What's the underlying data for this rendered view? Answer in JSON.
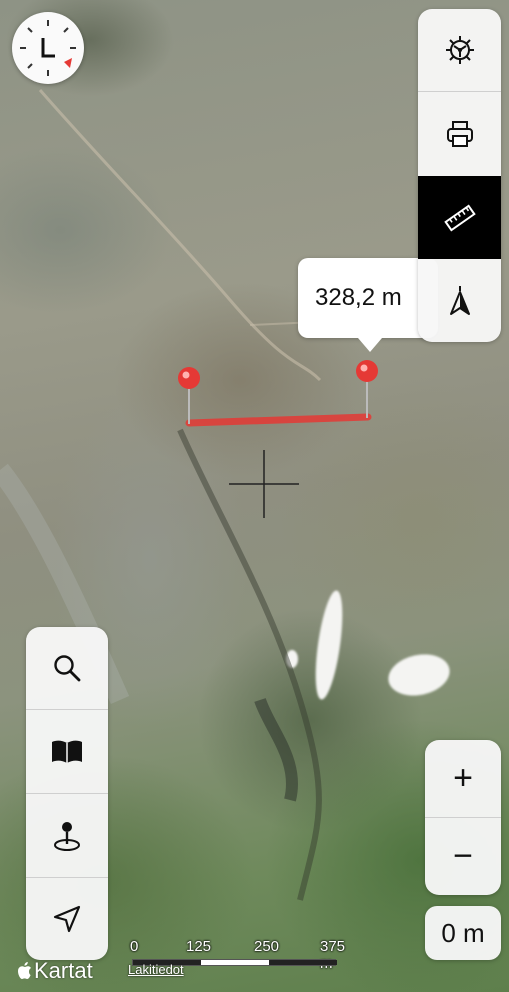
{
  "map": {
    "attribution": "Lakitiedot",
    "logo_text": "Kartat"
  },
  "measure": {
    "distance_label": "328,2 m"
  },
  "top_toolbar": {
    "items": [
      {
        "name": "settings",
        "icon": "gear-icon"
      },
      {
        "name": "print",
        "icon": "printer-icon"
      },
      {
        "name": "measure",
        "icon": "ruler-icon",
        "active": true
      },
      {
        "name": "north-up",
        "icon": "compass-arrow-icon"
      }
    ]
  },
  "left_toolbar": {
    "items": [
      {
        "name": "search",
        "icon": "search-icon"
      },
      {
        "name": "bookmarks",
        "icon": "book-icon"
      },
      {
        "name": "place-pin",
        "icon": "location-pin-icon"
      },
      {
        "name": "my-location",
        "icon": "navigation-arrow-icon"
      }
    ]
  },
  "zoom": {
    "in_label": "+",
    "out_label": "−",
    "altitude_label": "0 m"
  },
  "scale": {
    "labels": [
      "0",
      "125",
      "250",
      "375 m"
    ]
  },
  "colors": {
    "accent_red": "#e53935",
    "active_bg": "#000000",
    "panel_bg": "#f7f7f7"
  }
}
